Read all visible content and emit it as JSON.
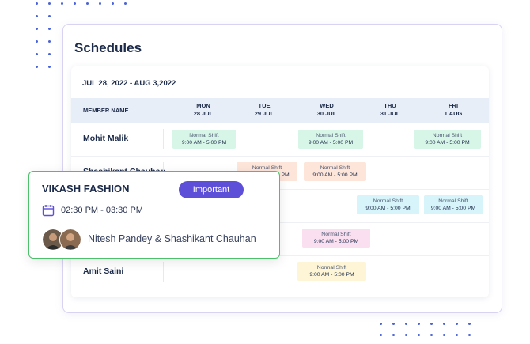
{
  "panel": {
    "title": "Schedules"
  },
  "schedule": {
    "date_range": "JUL 28, 2022 - AUG 3,2022",
    "member_header": "MEMBER NAME",
    "days": [
      {
        "day": "MON",
        "date": "28 JUL"
      },
      {
        "day": "TUE",
        "date": "29 JUL"
      },
      {
        "day": "WED",
        "date": "30 JUL"
      },
      {
        "day": "THU",
        "date": "31 JUL"
      },
      {
        "day": "FRI",
        "date": "1 AUG"
      }
    ],
    "rows": [
      {
        "name": "Mohit Malik"
      },
      {
        "name": "Shashikant Chauhan"
      },
      {
        "name": ""
      },
      {
        "name": ""
      },
      {
        "name": "Amit Saini"
      }
    ],
    "shift_label": "Normal Shift",
    "shift_hours": "9:00 AM - 5:00 PM",
    "partial_hours_tue": "9:00 AM - 5:00 PM",
    "colors": {
      "green": "#d8f6e8",
      "orange": "#fde5da",
      "cyan": "#d6f4f9",
      "pink": "#f9dff0",
      "yellow": "#fdf5d5",
      "accent": "#5e4fd9",
      "card_border": "#4cc06b"
    }
  },
  "card": {
    "title": "VIKASH FASHION",
    "badge": "Important",
    "icon": "calendar-icon",
    "time": "02:30 PM - 03:30 PM",
    "people": "Nitesh Pandey & Shashikant Chauhan"
  }
}
